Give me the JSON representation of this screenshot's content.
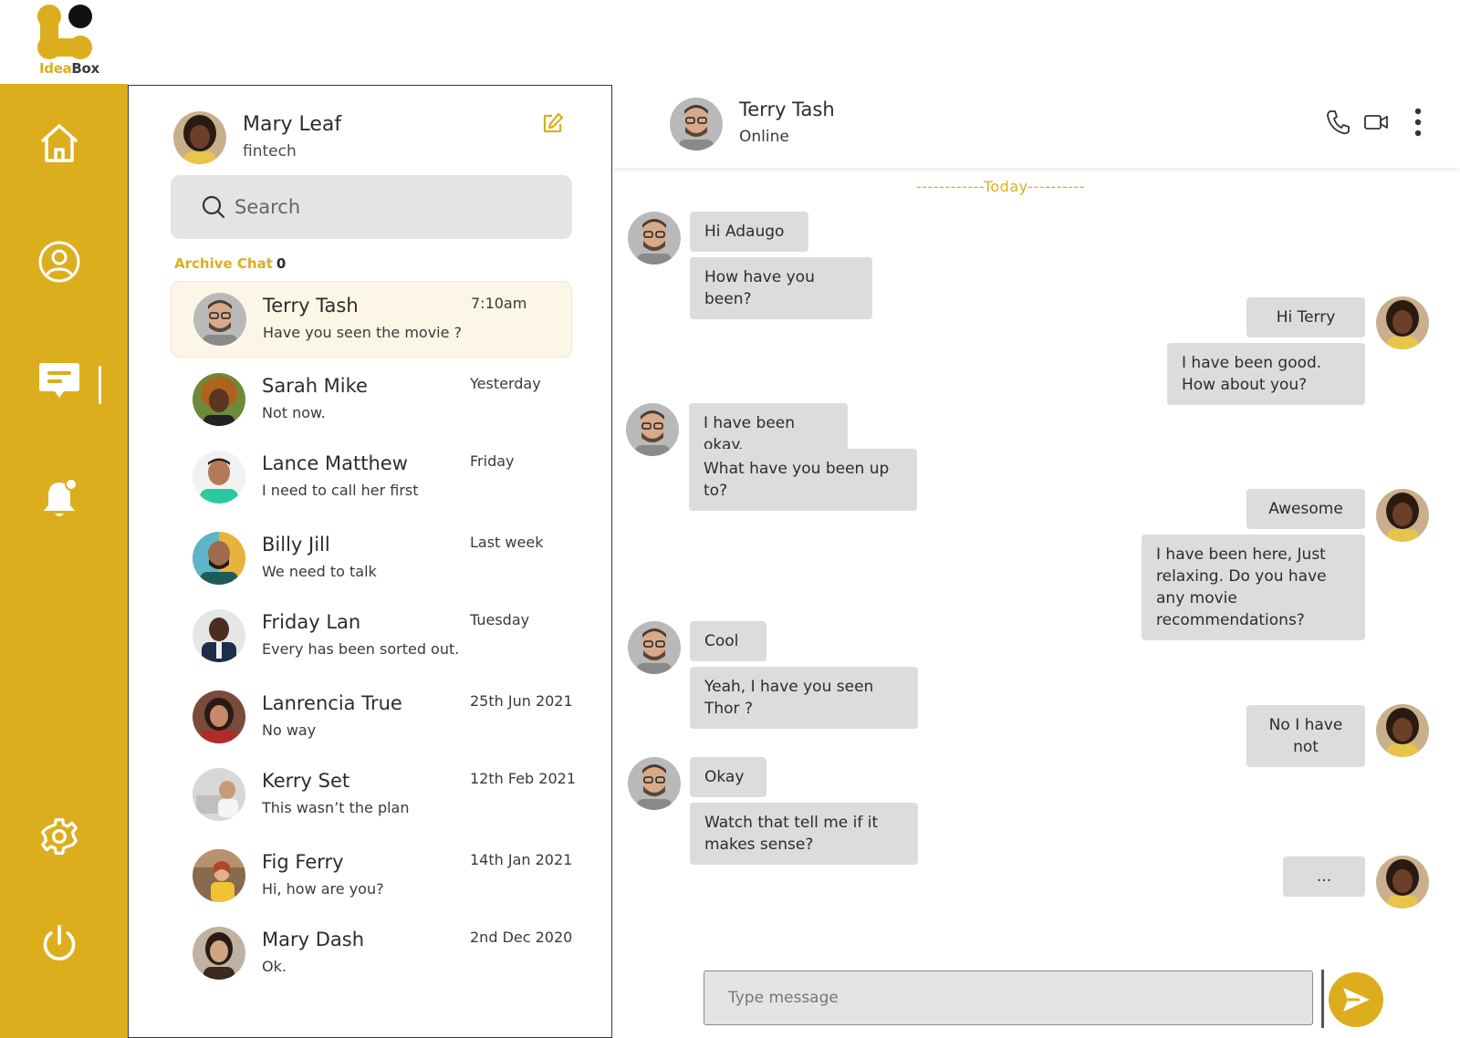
{
  "brand": {
    "name_part1": "Idea",
    "name_part2": "Box",
    "accent": "#dcae1d"
  },
  "sidebar": {
    "items": [
      {
        "name": "home-icon"
      },
      {
        "name": "profile-icon"
      },
      {
        "name": "chat-icon",
        "active": true
      },
      {
        "name": "notification-bell-icon"
      },
      {
        "name": "settings-icon"
      },
      {
        "name": "power-icon"
      }
    ]
  },
  "me": {
    "name": "Mary Leaf",
    "subtitle": "fintech"
  },
  "search": {
    "placeholder": "Search"
  },
  "archive": {
    "label": "Archive Chat",
    "count": "0"
  },
  "chats": [
    {
      "name": "Terry Tash",
      "preview": "Have you seen the movie ?",
      "time": "7:10am",
      "active": true
    },
    {
      "name": "Sarah Mike",
      "preview": "Not now.",
      "time": "Yesterday"
    },
    {
      "name": "Lance Matthew",
      "preview": "I need to call her first",
      "time": "Friday"
    },
    {
      "name": "Billy Jill",
      "preview": "We need to talk",
      "time": "Last week"
    },
    {
      "name": "Friday Lan",
      "preview": "Every has been sorted out.",
      "time": "Tuesday"
    },
    {
      "name": "Lanrencia True",
      "preview": "No way",
      "time": "25th Jun 2021"
    },
    {
      "name": "Kerry Set",
      "preview": "This wasn’t the plan",
      "time": "12th Feb 2021"
    },
    {
      "name": "Fig Ferry",
      "preview": "Hi, how are you?",
      "time": "14th Jan 2021"
    },
    {
      "name": "Mary Dash",
      "preview": "Ok.",
      "time": "2nd Dec 2020"
    }
  ],
  "conversation": {
    "contact_name": "Terry Tash",
    "contact_status": "Online",
    "day_divider": "------------Today----------",
    "messages": [
      {
        "from": "them",
        "text": "Hi Adaugo"
      },
      {
        "from": "them",
        "text": "How have you been?"
      },
      {
        "from": "me",
        "text": "Hi Terry"
      },
      {
        "from": "me",
        "text": "I have been good.  How about you?"
      },
      {
        "from": "them",
        "text": "I have been okay."
      },
      {
        "from": "them",
        "text": "What have you been up to?"
      },
      {
        "from": "me",
        "text": "Awesome"
      },
      {
        "from": "me",
        "text": "I have been here, Just relaxing. Do you have any movie recommendations?"
      },
      {
        "from": "them",
        "text": "Cool"
      },
      {
        "from": "them",
        "text": "Yeah, I have you seen Thor ?"
      },
      {
        "from": "me",
        "text": "No I have not"
      },
      {
        "from": "them",
        "text": "Okay"
      },
      {
        "from": "them",
        "text": "Watch that tell me if it makes sense?"
      },
      {
        "from": "me",
        "text": "..."
      }
    ]
  },
  "composer": {
    "placeholder": "Type message"
  }
}
